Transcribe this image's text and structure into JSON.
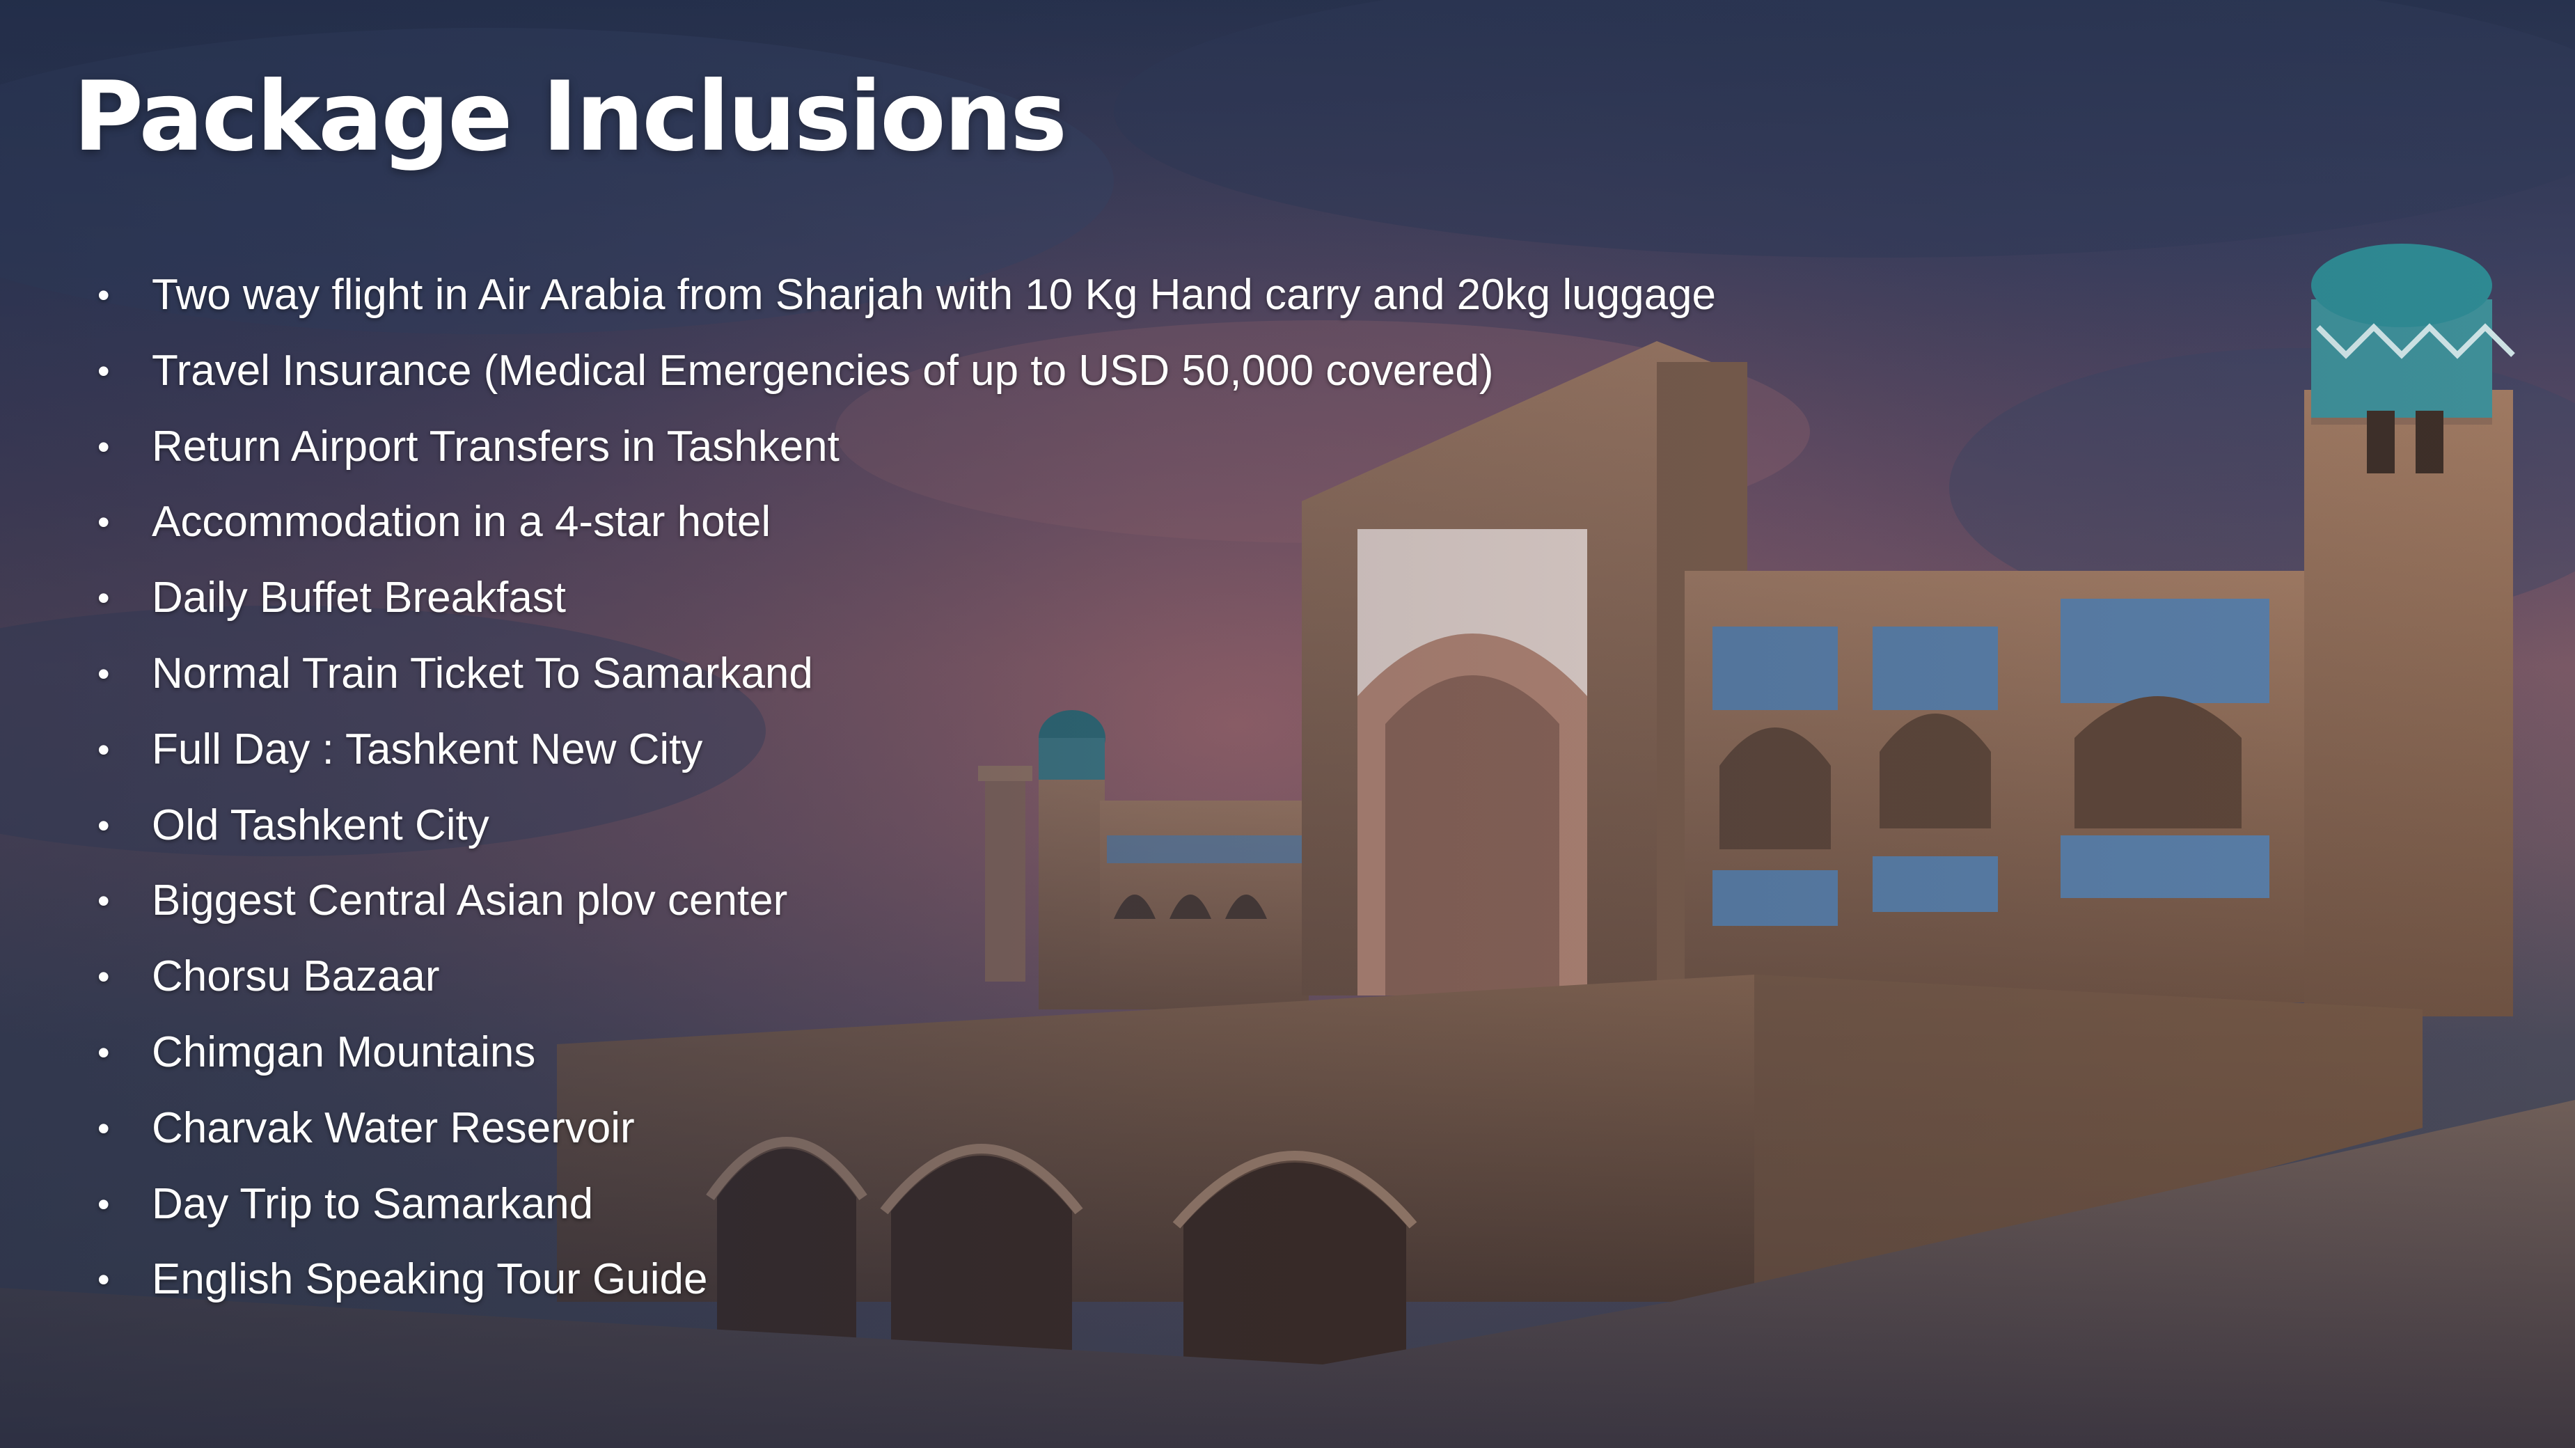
{
  "slide": {
    "title": "Package Inclusions",
    "bullet_char": "•",
    "items": [
      "Two way flight in Air Arabia from Sharjah with 10 Kg Hand carry and 20kg luggage",
      "Travel Insurance (Medical Emergencies of up to USD 50,000 covered)",
      "Return Airport Transfers in Tashkent",
      "Accommodation in a 4-star hotel",
      "Daily Buffet Breakfast",
      "Normal Train Ticket To Samarkand",
      "Full Day : Tashkent New City",
      "Old Tashkent City",
      "Biggest Central Asian plov center",
      "Chorsu Bazaar",
      "Chimgan Mountains",
      "Charvak Water Reservoir",
      "Day Trip to Samarkand",
      "English Speaking Tour Guide"
    ]
  },
  "background": {
    "sky_top": "#27324e",
    "sky_glow": "#8a5c68",
    "brick": "#8c6a55",
    "brick_dark": "#5e4638",
    "tile_blue": "#5a7fa8",
    "dome_teal": "#2e8a93",
    "ground": "#6a5a55"
  }
}
